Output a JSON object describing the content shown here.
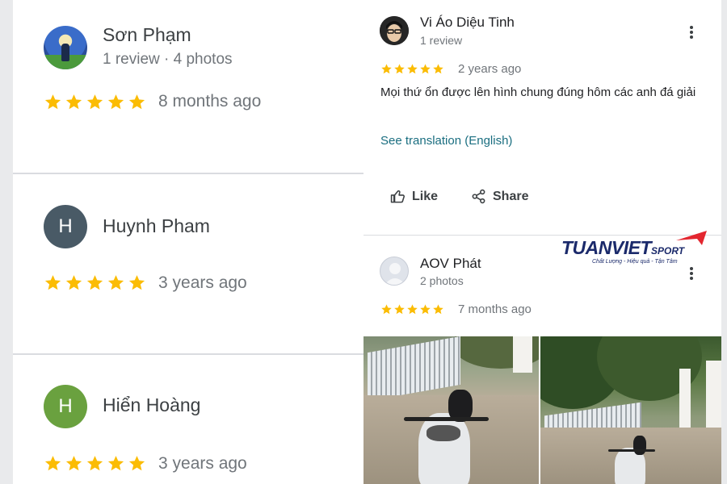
{
  "left_reviews": [
    {
      "name": "Sơn Phạm",
      "meta": "1 review · 4 photos",
      "rating": 5,
      "time": "8 months ago",
      "avatar_type": "photo"
    },
    {
      "name": "Huynh Pham",
      "meta": "",
      "rating": 5,
      "time": "3 years ago",
      "avatar_letter": "H",
      "avatar_color": "#495a66"
    },
    {
      "name": "Hiển Hoàng",
      "meta": "",
      "rating": 5,
      "time": "3 years ago",
      "avatar_letter": "H",
      "avatar_color": "#6aa13f"
    }
  ],
  "right_reviews": [
    {
      "name": "Vi Áo Diệu Tinh",
      "meta": "1 review",
      "rating": 5,
      "time": "2 years ago",
      "text": "Mọi thứ ổn được lên hình chung đúng hôm các anh đá giải",
      "translate": "See translation (English)",
      "like": "Like",
      "share": "Share"
    },
    {
      "name": "AOV Phát",
      "meta": "2 photos",
      "rating": 5,
      "time": "7 months ago"
    }
  ],
  "logo": {
    "brand": "TUANVIET",
    "sub": "SPORT",
    "tm": "TM",
    "slogan": "Chất Lượng - Hiệu quả - Tận Tâm"
  },
  "icons": {
    "star": "star-icon",
    "more": "more-vert-icon",
    "like": "thumb-up-icon",
    "share": "share-icon"
  },
  "colors": {
    "star": "#fbbc04",
    "link": "#1a6e80",
    "brand_navy": "#1b2a6b",
    "brand_red": "#e3262f"
  }
}
